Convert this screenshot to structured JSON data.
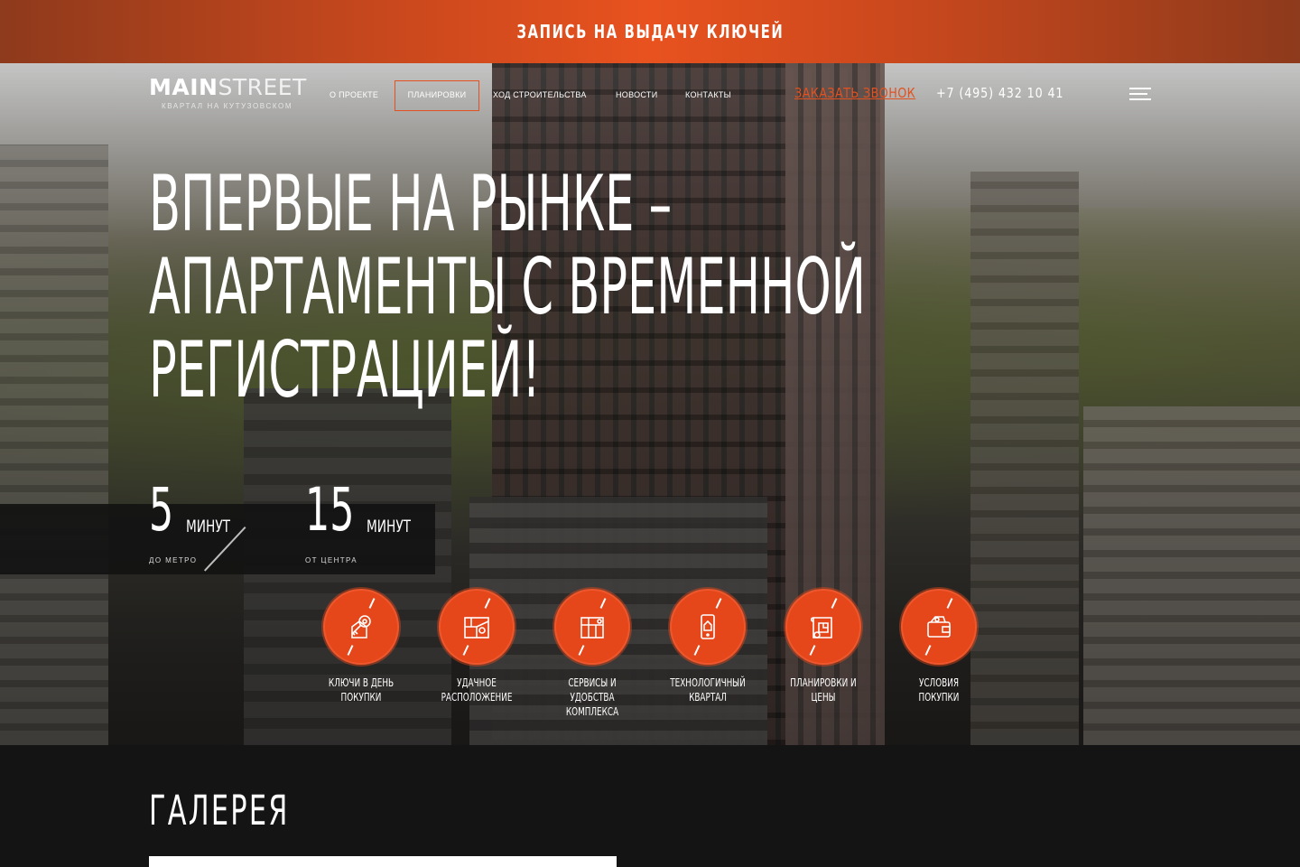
{
  "promo": {
    "text": "ЗАПИСЬ НА ВЫДАЧУ КЛЮЧЕЙ"
  },
  "logo": {
    "main": "MAIN",
    "street": "STREET",
    "subtitle": "КВАРТАЛ НА КУТУЗОВСКОМ"
  },
  "nav": {
    "items": [
      {
        "label": "О ПРОЕКТЕ"
      },
      {
        "label": "ПЛАНИРОВКИ"
      },
      {
        "label": "ХОД СТРОИТЕЛЬСТВА"
      },
      {
        "label": "НОВОСТИ"
      },
      {
        "label": "КОНТАКТЫ"
      }
    ],
    "callback": "ЗАКАЗАТЬ ЗВОНОК",
    "phone": "+7 (495) 432 10 41"
  },
  "hero": {
    "lines": [
      "ВПЕРВЫЕ НА РЫНКЕ –",
      "АПАРТАМЕНТЫ С ВРЕМЕННОЙ",
      "РЕГИСТРАЦИЕЙ!"
    ]
  },
  "stats": [
    {
      "number": "5",
      "unit": "МИНУТ",
      "caption": "ДО МЕТРО"
    },
    {
      "number": "15",
      "unit": "МИНУТ",
      "caption": "ОТ ЦЕНТРА"
    }
  ],
  "features": [
    {
      "icon": "keys-icon",
      "line1": "КЛЮЧИ В ДЕНЬ",
      "line2": "ПОКУПКИ"
    },
    {
      "icon": "map-location-icon",
      "line1": "УДАЧНОЕ",
      "line2": "РАСПОЛОЖЕНИЕ"
    },
    {
      "icon": "services-icon",
      "line1": "СЕРВИСЫ И УДОБСТВА",
      "line2": "КОМПЛЕКСА"
    },
    {
      "icon": "smart-home-icon",
      "line1": "ТЕХНОЛОГИЧНЫЙ",
      "line2": "КВАРТАЛ"
    },
    {
      "icon": "floor-plan-icon",
      "line1": "ПЛАНИРОВКИ И ЦЕНЫ",
      "line2": ""
    },
    {
      "icon": "wallet-icon",
      "line1": "УСЛОВИЯ ПОКУПКИ",
      "line2": ""
    }
  ],
  "gallery": {
    "title": "ГАЛЕРЕЯ"
  },
  "colors": {
    "accent": "#e5461a",
    "promo_center": "#e8521f",
    "dark": "#141414"
  }
}
